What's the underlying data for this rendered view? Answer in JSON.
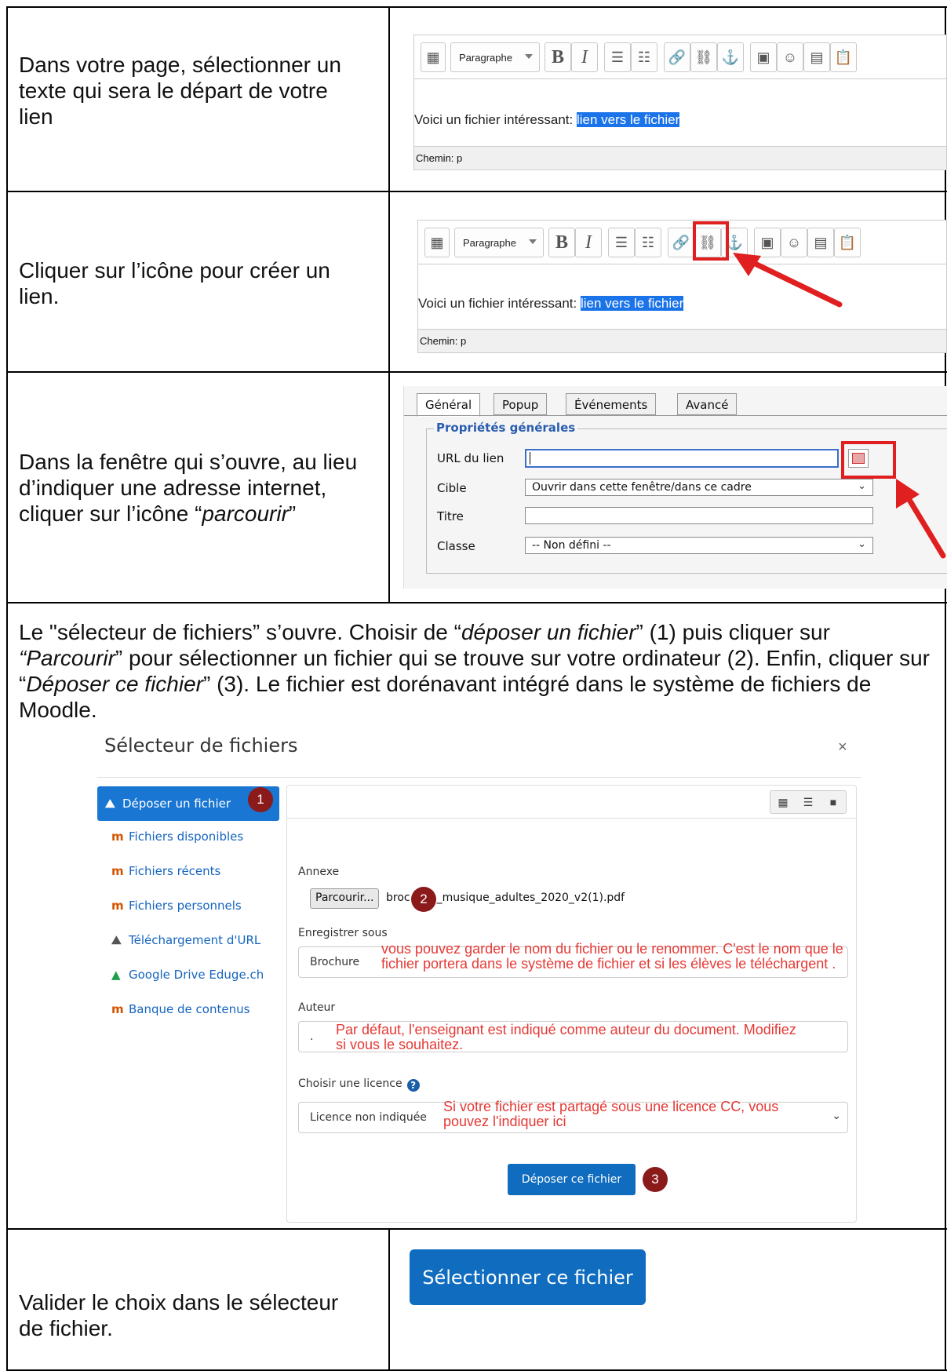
{
  "row1": {
    "instruction": "Dans votre page, sélectionner un texte qui sera le départ de votre lien",
    "editor": {
      "format_label": "Paragraphe",
      "body_text": "Voici un fichier intéressant: ",
      "selected_text": "lien vers le fichier",
      "status": "Chemin: p"
    }
  },
  "row2": {
    "instruction": "Cliquer sur l’icône pour créer un lien.",
    "editor": {
      "format_label": "Paragraphe",
      "body_text": "Voici un fichier intéressant: ",
      "selected_text": "lien vers le fichier",
      "status": "Chemin: p"
    }
  },
  "row3": {
    "instruction_start": "Dans la fenêtre qui s’ouvre, au lieu d’indiquer une adresse internet, cliquer sur l’icône “",
    "instruction_italic": "parcourir",
    "instruction_end": "”",
    "dialog": {
      "tabs": [
        "Général",
        "Popup",
        "Événements",
        "Avancé"
      ],
      "legend": "Propriétés générales",
      "url_label": "URL du lien",
      "target_label": "Cible",
      "target_value": "Ouvrir dans cette fenêtre/dans ce cadre",
      "title_label": "Titre",
      "class_label": "Classe",
      "class_value": "-- Non défini --"
    }
  },
  "row4": {
    "p1": "Le \"sélecteur de fichiers” s’ouvre. Choisir de “",
    "p1_it": "déposer un fichier",
    "p2": "” (1) puis cliquer sur ",
    "p2_it": "“Parcourir",
    "p3": "” pour sélectionner un fichier qui se trouve sur votre ordinateur (2). Enfin, cliquer sur “",
    "p3_it": "Déposer ce fichier",
    "p4": "” (3). Le fichier est dorénavant intégré dans le système de fichiers de Moodle.",
    "picker": {
      "title": "Sélecteur de fichiers",
      "close": "×",
      "nav": [
        {
          "label": "Déposer un fichier",
          "icon": "upload-icon"
        },
        {
          "label": "Fichiers disponibles",
          "icon": "moodle-icon"
        },
        {
          "label": "Fichiers récents",
          "icon": "moodle-icon"
        },
        {
          "label": "Fichiers personnels",
          "icon": "moodle-icon"
        },
        {
          "label": "Téléchargement d'URL",
          "icon": "url-icon"
        },
        {
          "label": "Google Drive Eduge.ch",
          "icon": "google-drive-icon"
        },
        {
          "label": "Banque de contenus",
          "icon": "moodle-icon"
        }
      ],
      "annexe_label": "Annexe",
      "browse_label": "Parcourir...",
      "file_start": "broc",
      "file_end": "_musique_adultes_2020_v2(1).pdf",
      "save_as_label": "Enregistrer sous",
      "save_as_value": "Brochure",
      "save_as_note": "vous pouvez garder le nom du fichier ou le renommer. C'est le nom que le fichier portera dans le système de fichier et si les élèves le téléchargent .",
      "author_label": "Auteur",
      "author_value": ".",
      "author_note": "Par défaut, l'enseignant est indiqué comme auteur du document. Modifiez si vous le souhaitez.",
      "license_label": "Choisir une licence",
      "license_value": "Licence non indiquée",
      "license_note": "Si votre fichier est partagé sous une licence CC, vous pouvez l'indiquer ici",
      "upload_button": "Déposer ce fichier",
      "badges": [
        "1",
        "2",
        "3"
      ]
    }
  },
  "row5": {
    "instruction": "Valider le choix dans le sélecteur de fichier.",
    "button": "Sélectionner ce fichier"
  },
  "colors": {
    "accent_blue": "#1976d2",
    "highlight": "#1a73e8",
    "annotation_red": "#e53935",
    "badge": "#8b1a1a"
  }
}
